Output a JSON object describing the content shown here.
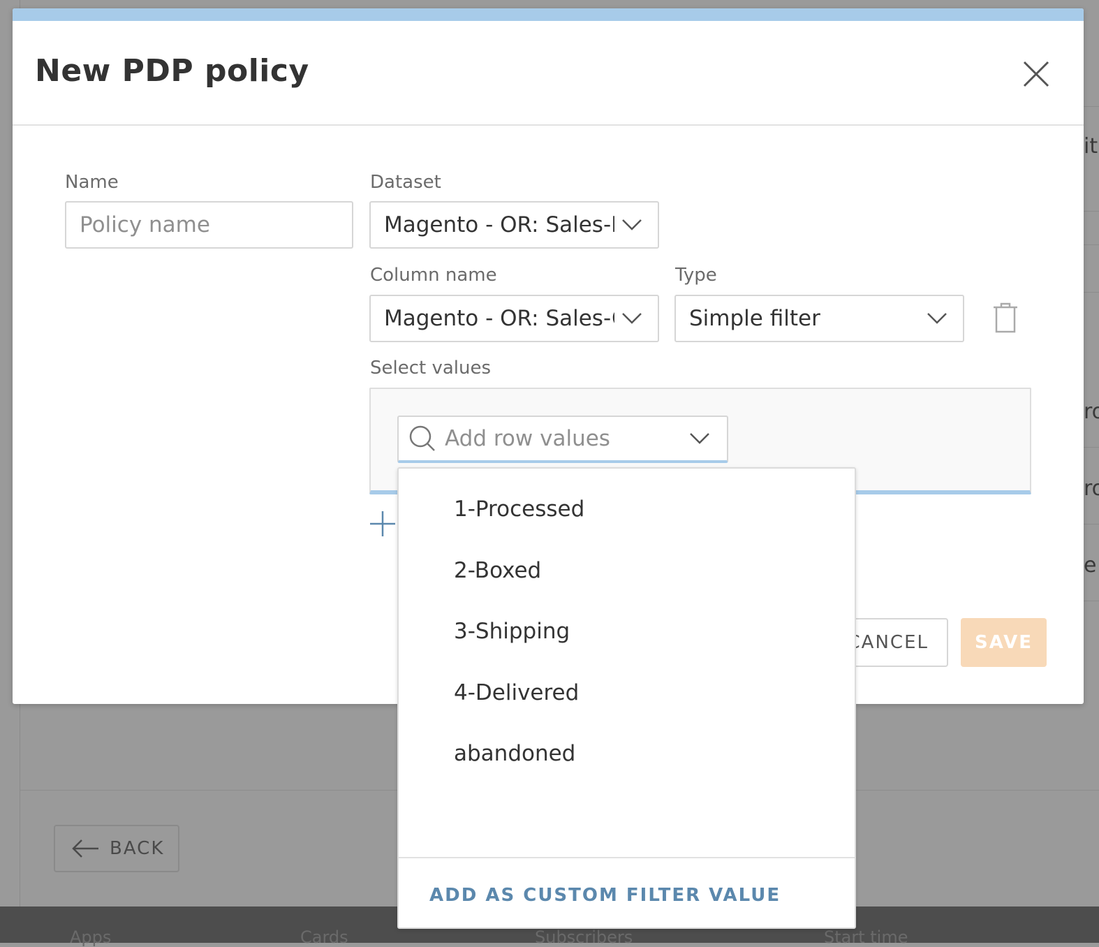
{
  "background": {
    "back_label": "BACK",
    "footer_columns": [
      "Apps",
      "Cards",
      "Subscribers",
      "Start time"
    ],
    "fragments": [
      "it",
      "ro",
      "ro",
      "e"
    ]
  },
  "modal": {
    "title": "New PDP policy",
    "name": {
      "label": "Name",
      "placeholder": "Policy name"
    },
    "dataset": {
      "label": "Dataset",
      "value": "Magento - OR: Sales-New"
    },
    "column_name": {
      "label": "Column name",
      "value": "Magento - OR: Sales-Order"
    },
    "type": {
      "label": "Type",
      "value": "Simple filter"
    },
    "select_values": {
      "label": "Select values",
      "search_placeholder": "Add row values"
    },
    "cancel_label": "CANCEL",
    "save_label": "SAVE"
  },
  "dropdown": {
    "options": [
      "1-Processed",
      "2-Boxed",
      "3-Shipping",
      "4-Delivered",
      "abandoned"
    ],
    "custom_action": "ADD AS CUSTOM FILTER VALUE"
  },
  "colors": {
    "accent_bar": "#a7cbe9",
    "save_disabled": "#f8d9b8",
    "link": "#5b88ad"
  }
}
